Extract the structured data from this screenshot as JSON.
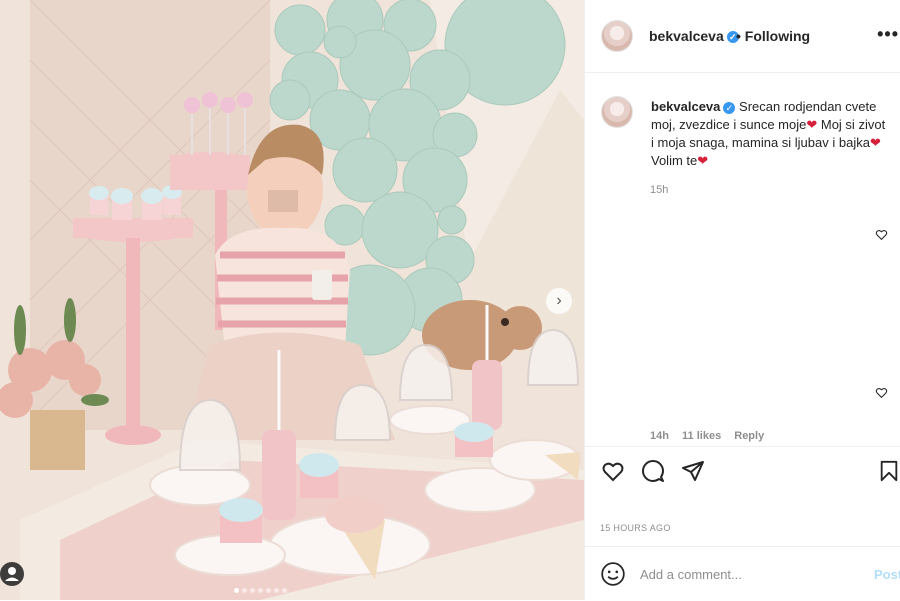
{
  "post": {
    "username": "bekvalceva",
    "verified_mark": "✓",
    "following_label": "• Following",
    "more_label": "•••"
  },
  "caption": {
    "username": "bekvalceva",
    "line1": "Srecan rodjendan cvete",
    "line2": "moj, zvezdice i sunce moje",
    "line3": "Moj si",
    "line4": "zivot i moja snaga, mamina si ljubav i",
    "line5": "bajka",
    "line6": "Volim te",
    "heart_emoji": "❤",
    "time": "15h"
  },
  "comment": {
    "time": "14h",
    "likes": "11 likes",
    "reply": "Reply"
  },
  "footer": {
    "timestamp": "15 HOURS AGO",
    "add_comment_placeholder": "Add a comment...",
    "post_label": "Post"
  },
  "carousel": {
    "next_label": "›",
    "dots": 7,
    "active_dot": 0
  },
  "icons": [
    "heart-icon",
    "comment-icon",
    "share-icon",
    "bookmark-icon",
    "emoji-icon",
    "user-tag-icon",
    "verified-icon",
    "more-options-icon",
    "chevron-right-icon"
  ],
  "colors": {
    "link_blue": "#3897f0",
    "post_disabled": "#b2dffc",
    "muted_text": "#8e8e8e",
    "photo_bg": "#efe2d8",
    "balloon_mint": "#bcd8cc"
  }
}
